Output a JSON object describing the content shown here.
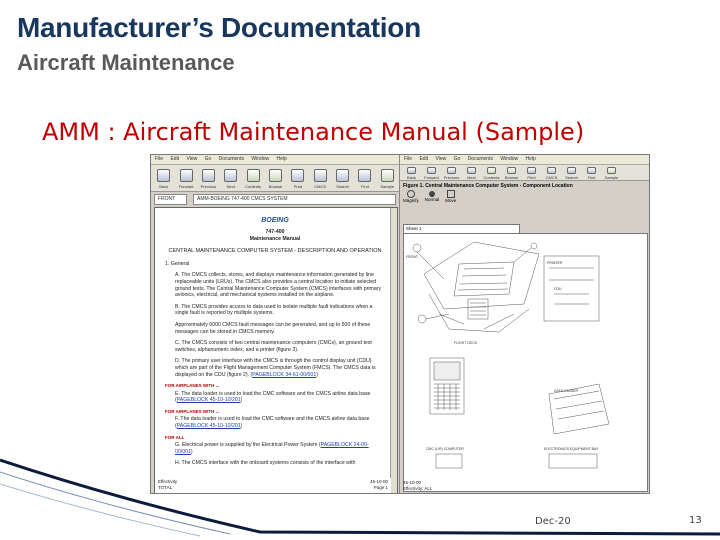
{
  "slide": {
    "title": "Manufacturer’s Documentation",
    "subtitle": "Aircraft Maintenance",
    "heading": "AMM : Aircraft Maintenance Manual (Sample)",
    "date": "Dec-20",
    "page_number": "13"
  },
  "left_window": {
    "menu": [
      "File",
      "Edit",
      "View",
      "Go",
      "Documents",
      "Window",
      "Help"
    ],
    "toolbar": [
      "Back",
      "Forward",
      "Previous",
      "Next",
      "Contents",
      "Browse",
      "Print",
      "CMCS",
      "Search",
      "Find",
      "Sample"
    ],
    "address_left": "FRONT",
    "address_text": "AMM-BOEING 747-400 CMCS SYSTEM",
    "doc": {
      "logo": "BOEING",
      "model": "747-400",
      "manual": "Maintenance Manual",
      "section_title": "CENTRAL MAINTENANCE COMPUTER SYSTEM - DESCRIPTION AND OPERATION",
      "general_num": "1.",
      "general_label": "General",
      "para_a_label": "A.",
      "para_a": "The CMCS collects, stores, and displays maintenance information generated by line replaceable units (LRUs). The CMCS also provides a central location to initiate selected ground tests. The Central Maintenance Computer System (CMCS) interfaces with primary avionics, electrical, and mechanical systems installed on the airplane.",
      "para_b_label": "B.",
      "para_b": "The CMCS provides access to data used to isolate multiple fault indications when a single fault is reported by multiple systems.",
      "para_plain": "Approximately 6000 CMCS fault messages can be generated, and up to 500 of these messages can be stored in CMCS memory.",
      "para_c_label": "C.",
      "para_c": "The CMCS consists of two central maintenance computers (CMCs), an ground test switches, alphanumeric index, and a printer (figure 3).",
      "para_d_label": "D.",
      "para_d": "The primary user interface with the CMCS is through the control display unit (CDU) which are part of the Flight Management Computer System (FMCS). The CMCS data is displayed on the CDU (figure 2).",
      "link_1": "PAGEBLOCK 34-61-00/001",
      "red_1": "FOR AIRPLANES WITH ...",
      "para_e_label": "E.",
      "para_e": "The data loader is used to load the CMC software and the CMCS airline data base",
      "link_2": "PAGEBLOCK 45-10-10/201",
      "red_2": "FOR AIRPLANES WITH ...",
      "para_f_label": "F.",
      "para_f": "The data loader is used to load the CMC software and the CMCS airline data base",
      "link_3": "PAGEBLOCK 45-10-10/201",
      "red_3": "FOR ALL",
      "para_g_label": "G.",
      "para_g": "Electrical power is supplied by the Electrical Power System",
      "link_4": "PAGEBLOCK 24-00-00/001",
      "para_h_label": "H.",
      "para_h": "The CMCS interface with the onboard systems consists of the interface with"
    },
    "footer_left_1": "Effectivity",
    "footer_left_2": "TOTAL",
    "footer_right_1": "45-10-00",
    "footer_right_2": "Page 1"
  },
  "right_window": {
    "menu": [
      "File",
      "Edit",
      "View",
      "Go",
      "Documents",
      "Window",
      "Help"
    ],
    "toolbar": [
      "Back",
      "Forward",
      "Previous",
      "Next",
      "Contents",
      "Browse",
      "Print",
      "CMCS",
      "Search",
      "Find",
      "Sample"
    ],
    "figure_title": "Figure 1. Central Maintenance Computer System - Component Location",
    "view_buttons": [
      "Magnify",
      "Normal",
      "Move"
    ],
    "sheet": "Sheet 1",
    "labels": {
      "cdu_label": "CDU",
      "printer_label": "PRINTER",
      "panel_label": "DATA LOADER",
      "cockpit_label": "FLIGHT DECK",
      "front_label": "FRONT",
      "bottom_left": "CMC (L/R) COMPUTER",
      "bottom_right": "ELECTRONICS EQUIPMENT BAY"
    },
    "footer_left_1": "45-10-00",
    "footer_left_2": "Effectivity: ALL"
  },
  "colors": {
    "title": "#17375e",
    "subtitle": "#595959",
    "heading": "#c00000",
    "decor_line": "#0b1a3d"
  }
}
